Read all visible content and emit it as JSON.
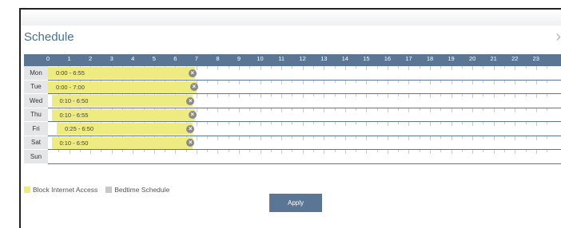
{
  "dialog": {
    "title": "Schedule",
    "close_icon": "close-chevron-icon"
  },
  "hours": [
    "0",
    "1",
    "2",
    "3",
    "4",
    "5",
    "6",
    "7",
    "8",
    "9",
    "10",
    "11",
    "12",
    "13",
    "14",
    "15",
    "16",
    "17",
    "18",
    "19",
    "20",
    "21",
    "22",
    "23"
  ],
  "days": [
    {
      "label": "Mon",
      "block_label": "0:00 - 6:55",
      "start": 0.0,
      "end": 6.92
    },
    {
      "label": "Tue",
      "block_label": "0:00 - 7:00",
      "start": 0.0,
      "end": 7.0
    },
    {
      "label": "Wed",
      "block_label": "0:10 - 6:50",
      "start": 0.17,
      "end": 6.83
    },
    {
      "label": "Thu",
      "block_label": "0:10 - 6:55",
      "start": 0.17,
      "end": 6.92
    },
    {
      "label": "Fri",
      "block_label": "0:25 - 6:50",
      "start": 0.42,
      "end": 6.83
    },
    {
      "label": "Sat",
      "block_label": "0:10 - 6:50",
      "start": 0.17,
      "end": 6.83
    },
    {
      "label": "Sun",
      "block_label": "",
      "start": null,
      "end": null
    }
  ],
  "legend": {
    "block": {
      "label": "Block Internet Access",
      "color": "#eeeb83"
    },
    "bedtime": {
      "label": "Bedtime Schedule",
      "color": "#c8c8c8"
    }
  },
  "apply_label": "Apply",
  "colors": {
    "header": "#5b7694",
    "title": "#4a6f8f"
  }
}
